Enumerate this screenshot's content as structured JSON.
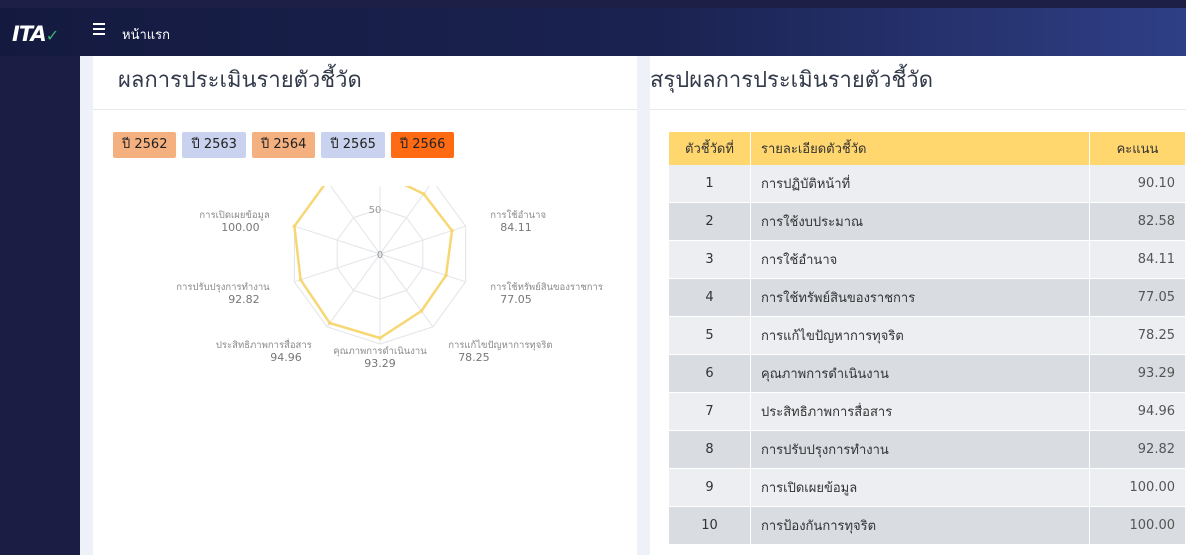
{
  "nav": {
    "logo_text": "ITA",
    "title": "หน้าแรก"
  },
  "left_card": {
    "title": "ผลการประเมินรายตัวชี้วัด",
    "year_buttons": [
      {
        "label": "ปี 2562",
        "color": "#f5b07f"
      },
      {
        "label": "ปี 2563",
        "color": "#c9d2ee"
      },
      {
        "label": "ปี 2564",
        "color": "#f5b07f"
      },
      {
        "label": "ปี 2565",
        "color": "#c9d2ee"
      },
      {
        "label": "ปี 2566",
        "color": "#ff6a13"
      }
    ]
  },
  "chart_data": {
    "type": "radar",
    "scale_max": 100,
    "ticks": [
      "0",
      "50"
    ],
    "line_color": "#f7d774",
    "indicators": [
      {
        "label": "การปฏิบัติหน้าที่",
        "value": 90.1,
        "value_text": "90.10"
      },
      {
        "label": "การใช้งบประมาณ",
        "value": 82.58,
        "value_text": "82.58"
      },
      {
        "label": "การใช้อำนาจ",
        "value": 84.11,
        "value_text": "84.11"
      },
      {
        "label": "การใช้ทรัพย์สินของราชการ",
        "value": 77.05,
        "value_text": "77.05"
      },
      {
        "label": "การแก้ไขปัญหาการทุจริต",
        "value": 78.25,
        "value_text": "78.25"
      },
      {
        "label": "คุณภาพการดำเนินงาน",
        "value": 93.29,
        "value_text": "93.29"
      },
      {
        "label": "ประสิทธิภาพการสื่อสาร",
        "value": 94.96,
        "value_text": "94.96"
      },
      {
        "label": "การปรับปรุงการทำงาน",
        "value": 92.82,
        "value_text": "92.82"
      },
      {
        "label": "การเปิดเผยข้อมูล",
        "value": 100.0,
        "value_text": "100.00"
      },
      {
        "label": "การป้องกันการทุจริต",
        "value": 100.0,
        "value_text": "100.00"
      }
    ]
  },
  "right_card": {
    "title": "สรุปผลการประเมินรายตัวชี้วัด",
    "table": {
      "headers": {
        "no": "ตัวชี้วัดที่",
        "detail": "รายละเอียดตัวชี้วัด",
        "score": "คะแนน"
      },
      "rows": [
        {
          "no": "1",
          "detail": "การปฏิบัติหน้าที่",
          "score": "90.10"
        },
        {
          "no": "2",
          "detail": "การใช้งบประมาณ",
          "score": "82.58"
        },
        {
          "no": "3",
          "detail": "การใช้อำนาจ",
          "score": "84.11"
        },
        {
          "no": "4",
          "detail": "การใช้ทรัพย์สินของราชการ",
          "score": "77.05"
        },
        {
          "no": "5",
          "detail": "การแก้ไขปัญหาการทุจริต",
          "score": "78.25"
        },
        {
          "no": "6",
          "detail": "คุณภาพการดำเนินงาน",
          "score": "93.29"
        },
        {
          "no": "7",
          "detail": "ประสิทธิภาพการสื่อสาร",
          "score": "94.96"
        },
        {
          "no": "8",
          "detail": "การปรับปรุงการทำงาน",
          "score": "92.82"
        },
        {
          "no": "9",
          "detail": "การเปิดเผยข้อมูล",
          "score": "100.00"
        },
        {
          "no": "10",
          "detail": "การป้องกันการทุจริต",
          "score": "100.00"
        }
      ]
    }
  }
}
